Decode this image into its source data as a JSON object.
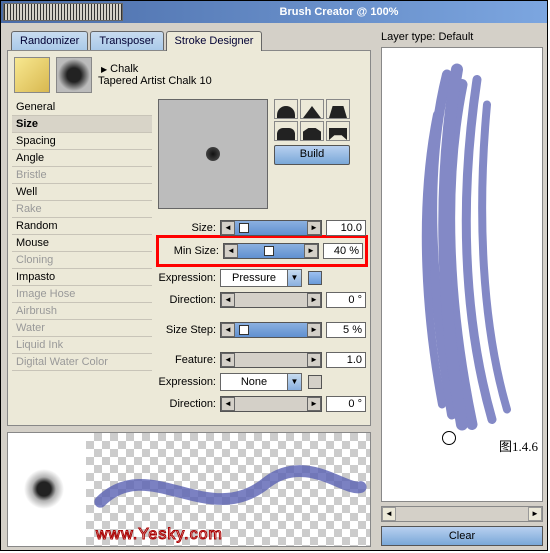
{
  "title": "Brush Creator @ 100%",
  "layertype_label": "Layer type: Default",
  "tabs": {
    "randomizer": "Randomizer",
    "transposer": "Transposer",
    "stroke": "Stroke Designer"
  },
  "brush": {
    "name": "Chalk",
    "variant": "Tapered Artist Chalk 10"
  },
  "cats": [
    "General",
    "Size",
    "Spacing",
    "Angle",
    "Bristle",
    "Well",
    "Rake",
    "Random",
    "Mouse",
    "Cloning",
    "Impasto",
    "Image Hose",
    "Airbrush",
    "Water",
    "Liquid Ink",
    "Digital Water Color"
  ],
  "build_btn": "Build",
  "rows": {
    "size": {
      "label": "Size:",
      "value": "10.0"
    },
    "minsize": {
      "label": "Min Size:",
      "value": "40 %"
    },
    "expr1": {
      "label": "Expression:",
      "value": "Pressure"
    },
    "dir1": {
      "label": "Direction:",
      "value": "0 °"
    },
    "step": {
      "label": "Size Step:",
      "value": "5 %"
    },
    "feature": {
      "label": "Feature:",
      "value": "1.0"
    },
    "expr2": {
      "label": "Expression:",
      "value": "None"
    },
    "dir2": {
      "label": "Direction:",
      "value": "0 °"
    }
  },
  "clear_btn": "Clear",
  "watermark": "www.Yesky.com",
  "fig": "图1.4.6"
}
